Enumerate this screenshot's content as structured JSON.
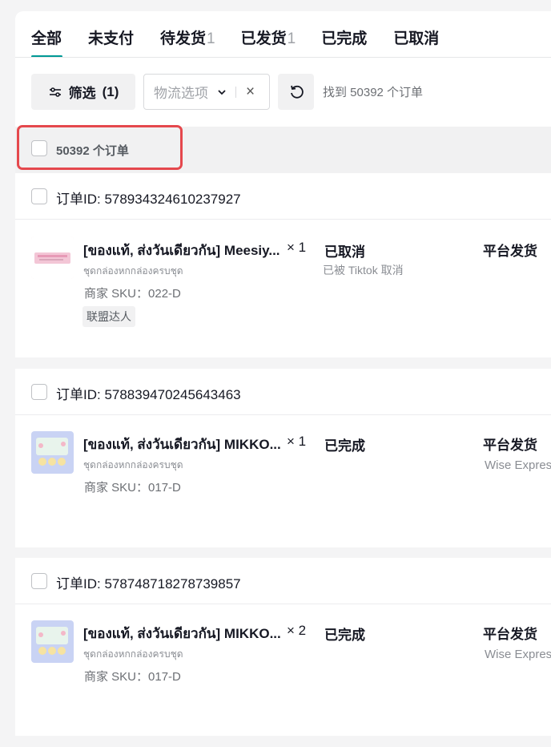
{
  "tabs": [
    {
      "label": "全部",
      "count": ""
    },
    {
      "label": "未支付",
      "count": ""
    },
    {
      "label": "待发货",
      "count": "1"
    },
    {
      "label": "已发货",
      "count": "1"
    },
    {
      "label": "已完成",
      "count": ""
    },
    {
      "label": "已取消",
      "count": ""
    }
  ],
  "active_tab": "全部",
  "toolbar": {
    "filter_label": "筛选",
    "filter_count": "(1)",
    "logistics_placeholder": "物流选项",
    "found_text": "找到 50392 个订单"
  },
  "select_all": {
    "label": "50392 个订单"
  },
  "colors": {
    "accent": "#009995",
    "highlight_box": "#e5484d"
  },
  "orders": [
    {
      "order_id": "订单ID: 578934324610237927",
      "product_name": "[ของแท้, ส่งวันเดียวกัน] Meesiy...",
      "quantity": "× 1",
      "variant": "ชุดกล่องหกกล่องครบชุด",
      "sku": "商家 SKU：022-D",
      "tag": "联盟达人",
      "status": "已取消",
      "status_detail": "已被 Tiktok 取消",
      "shipping": "平台发货",
      "carrier": ""
    },
    {
      "order_id": "订单ID: 578839470245643463",
      "product_name": "[ของแท้, ส่งวันเดียวกัน] MIKKO...",
      "quantity": "× 1",
      "variant": "ชุดกล่องหกกล่องครบชุด",
      "sku": "商家 SKU：017-D",
      "tag": "",
      "status": "已完成",
      "status_detail": "",
      "shipping": "平台发货",
      "carrier": "Wise Expres"
    },
    {
      "order_id": "订单ID: 578748718278739857",
      "product_name": "[ของแท้, ส่งวันเดียวกัน] MIKKO...",
      "quantity": "× 2",
      "variant": "ชุดกล่องหกกล่องครบชุด",
      "sku": "商家 SKU：017-D",
      "tag": "",
      "status": "已完成",
      "status_detail": "",
      "shipping": "平台发货",
      "carrier": "Wise Expres"
    }
  ]
}
